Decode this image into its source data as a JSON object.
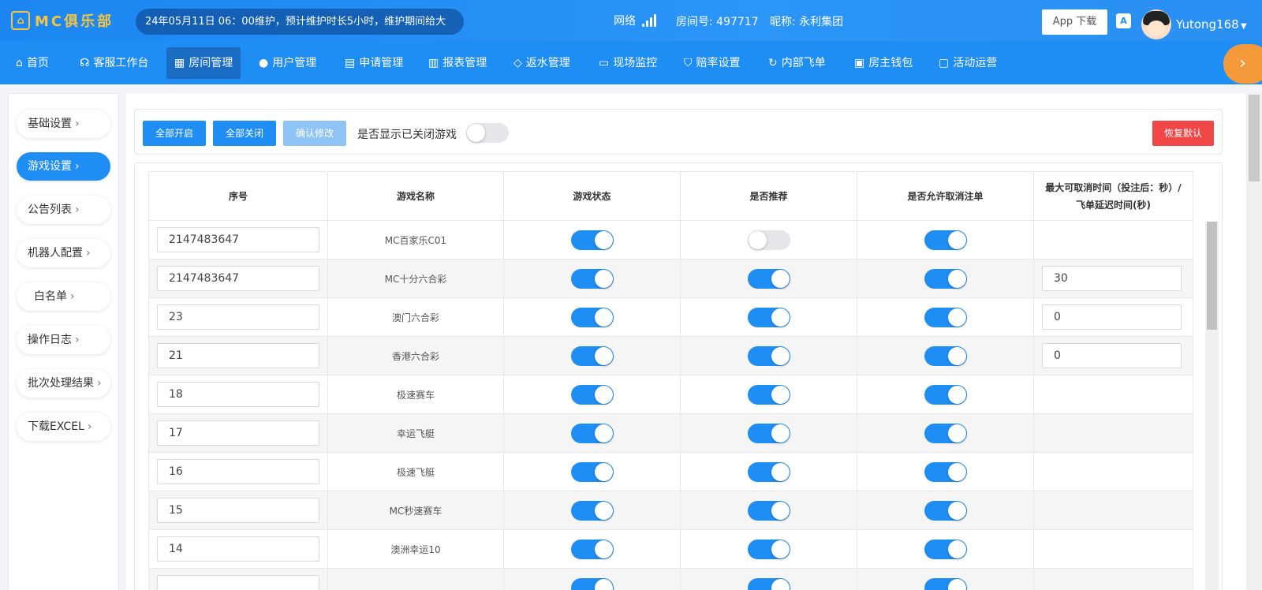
{
  "header": {
    "logo_text": "MC俱乐部",
    "notice": "24年05月11日 06：00维护，预计维护时长5小时，维护期间给大",
    "network_label": "网络",
    "room_label": "房间号: 497717",
    "nickname_label": "昵称: 永利集团",
    "app_download": "App 下载",
    "translate_glyph": "A",
    "username": "Yutong168"
  },
  "nav": [
    {
      "label": "首页",
      "icon": "home-icon"
    },
    {
      "label": "客服工作台",
      "icon": "headset-icon"
    },
    {
      "label": "房间管理",
      "icon": "grid-icon"
    },
    {
      "label": "用户管理",
      "icon": "user-icon"
    },
    {
      "label": "申请管理",
      "icon": "form-icon"
    },
    {
      "label": "报表管理",
      "icon": "bar-chart-icon"
    },
    {
      "label": "返水管理",
      "icon": "tag-icon"
    },
    {
      "label": "现场监控",
      "icon": "monitor-icon"
    },
    {
      "label": "赔率设置",
      "icon": "shield-icon"
    },
    {
      "label": "内部飞单",
      "icon": "refresh-icon"
    },
    {
      "label": "房主钱包",
      "icon": "wallet-icon"
    },
    {
      "label": "活动运营",
      "icon": "clipboard-icon"
    }
  ],
  "sidebar": [
    {
      "label": "基础设置"
    },
    {
      "label": "游戏设置"
    },
    {
      "label": "公告列表"
    },
    {
      "label": "机器人配置"
    },
    {
      "label": "白名单"
    },
    {
      "label": "操作日志"
    },
    {
      "label": "批次处理结果"
    },
    {
      "label": "下载EXCEL"
    }
  ],
  "toolbar": {
    "open_all": "全部开启",
    "close_all": "全部关闭",
    "confirm": "确认修改",
    "show_closed_label": "是否显示已关闭游戏",
    "show_closed_on": false,
    "restore": "恢复默认"
  },
  "table": {
    "headers": {
      "seq": "序号",
      "name": "游戏名称",
      "status": "游戏状态",
      "recommend": "是否推荐",
      "allow_cancel": "是否允许取消注单",
      "max_cancel_line1": "最大可取消时间（投注后：秒）/",
      "max_cancel_line2": "飞单延迟时间(秒)"
    },
    "rows": [
      {
        "seq": "2147483647",
        "name": "MC百家乐C01",
        "status": true,
        "recommend": false,
        "allow_cancel": true,
        "max_cancel": ""
      },
      {
        "seq": "2147483647",
        "name": "MC十分六合彩",
        "status": true,
        "recommend": true,
        "allow_cancel": true,
        "max_cancel": "30"
      },
      {
        "seq": "23",
        "name": "澳门六合彩",
        "status": true,
        "recommend": true,
        "allow_cancel": true,
        "max_cancel": "0"
      },
      {
        "seq": "21",
        "name": "香港六合彩",
        "status": true,
        "recommend": true,
        "allow_cancel": true,
        "max_cancel": "0"
      },
      {
        "seq": "18",
        "name": "极速赛车",
        "status": true,
        "recommend": true,
        "allow_cancel": true,
        "max_cancel": ""
      },
      {
        "seq": "17",
        "name": "幸运飞艇",
        "status": true,
        "recommend": true,
        "allow_cancel": true,
        "max_cancel": ""
      },
      {
        "seq": "16",
        "name": "极速飞艇",
        "status": true,
        "recommend": true,
        "allow_cancel": true,
        "max_cancel": ""
      },
      {
        "seq": "15",
        "name": "MC秒速赛车",
        "status": true,
        "recommend": true,
        "allow_cancel": true,
        "max_cancel": ""
      },
      {
        "seq": "14",
        "name": "澳洲幸运10",
        "status": true,
        "recommend": true,
        "allow_cancel": true,
        "max_cancel": ""
      },
      {
        "seq": "",
        "name": "",
        "status": true,
        "recommend": true,
        "allow_cancel": true,
        "max_cancel": ""
      }
    ]
  },
  "colors": {
    "primary": "#1f8ef4",
    "active_nav": "#1a6cc5",
    "danger": "#f24747",
    "logo_gold": "#f5c542",
    "more_orange": "#f59a3a"
  }
}
